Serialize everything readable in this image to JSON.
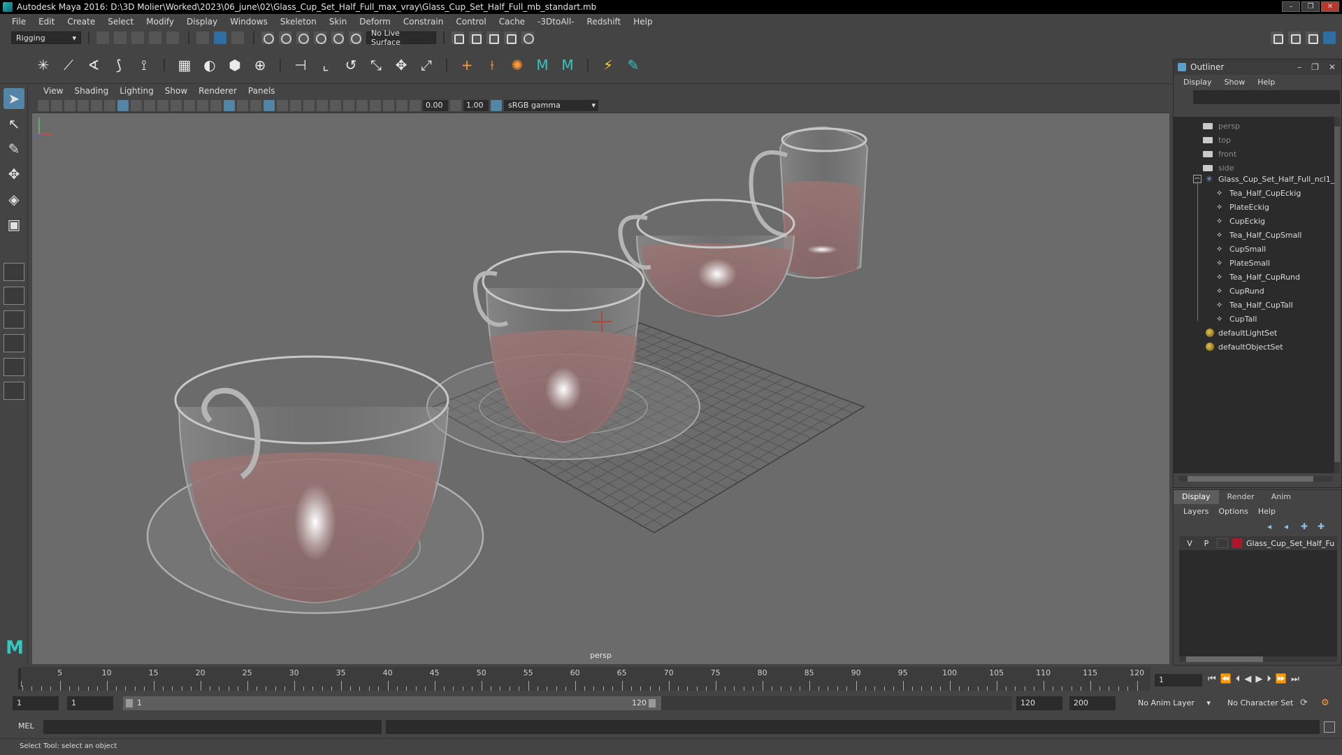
{
  "window": {
    "title": "Autodesk Maya 2016: D:\\3D Molier\\Worked\\2023\\06_june\\02\\Glass_Cup_Set_Half_Full_max_vray\\Glass_Cup_Set_Half_Full_mb_standart.mb",
    "controls": {
      "minimize": "–",
      "maximize": "❐",
      "close": "✕"
    }
  },
  "menubar": [
    "File",
    "Edit",
    "Create",
    "Select",
    "Modify",
    "Display",
    "Windows",
    "Skeleton",
    "Skin",
    "Deform",
    "Constrain",
    "Control",
    "Cache",
    "-3DtoAll-",
    "Redshift",
    "Help"
  ],
  "statusline": {
    "menuset": "Rigging",
    "live_surface": "No Live Surface"
  },
  "viewport": {
    "menu": [
      "View",
      "Shading",
      "Lighting",
      "Show",
      "Renderer",
      "Panels"
    ],
    "exposure": "0.00",
    "gamma": "1.00",
    "color_space": "sRGB gamma",
    "camera_label": "persp"
  },
  "outliner": {
    "title": "Outliner",
    "menu": [
      "Display",
      "Show",
      "Help"
    ],
    "cameras": [
      "persp",
      "top",
      "front",
      "side"
    ],
    "group": "Glass_Cup_Set_Half_Full_ncl1_",
    "children": [
      "Tea_Half_CupEckig",
      "PlateEckig",
      "CupEckig",
      "Tea_Half_CupSmall",
      "CupSmall",
      "PlateSmall",
      "Tea_Half_CupRund",
      "CupRund",
      "Tea_Half_CupTall",
      "CupTall"
    ],
    "sets": [
      "defaultLightSet",
      "defaultObjectSet"
    ]
  },
  "layer_editor": {
    "tabs": [
      "Display",
      "Render",
      "Anim"
    ],
    "active_tab": "Display",
    "menu": [
      "Layers",
      "Options",
      "Help"
    ],
    "layer": {
      "v": "V",
      "p": "P",
      "name": "Glass_Cup_Set_Half_Fu",
      "color": "#b0162a"
    }
  },
  "timeslider": {
    "labels": [
      "5",
      "10",
      "15",
      "20",
      "25",
      "30",
      "35",
      "40",
      "45",
      "50",
      "55",
      "60",
      "65",
      "70",
      "75",
      "80",
      "85",
      "90",
      "95",
      "100",
      "105",
      "110",
      "115",
      "120"
    ],
    "start_label": "1",
    "current_frame": "1"
  },
  "range": {
    "start": "1",
    "anim_start": "1",
    "range_start_label": "1",
    "range_end_label": "120",
    "playback_end": "120",
    "anim_end": "200",
    "anim_layer": "No Anim Layer",
    "character_set": "No Character Set"
  },
  "command_line": {
    "mode": "MEL"
  },
  "help_line": "Select Tool: select an object"
}
